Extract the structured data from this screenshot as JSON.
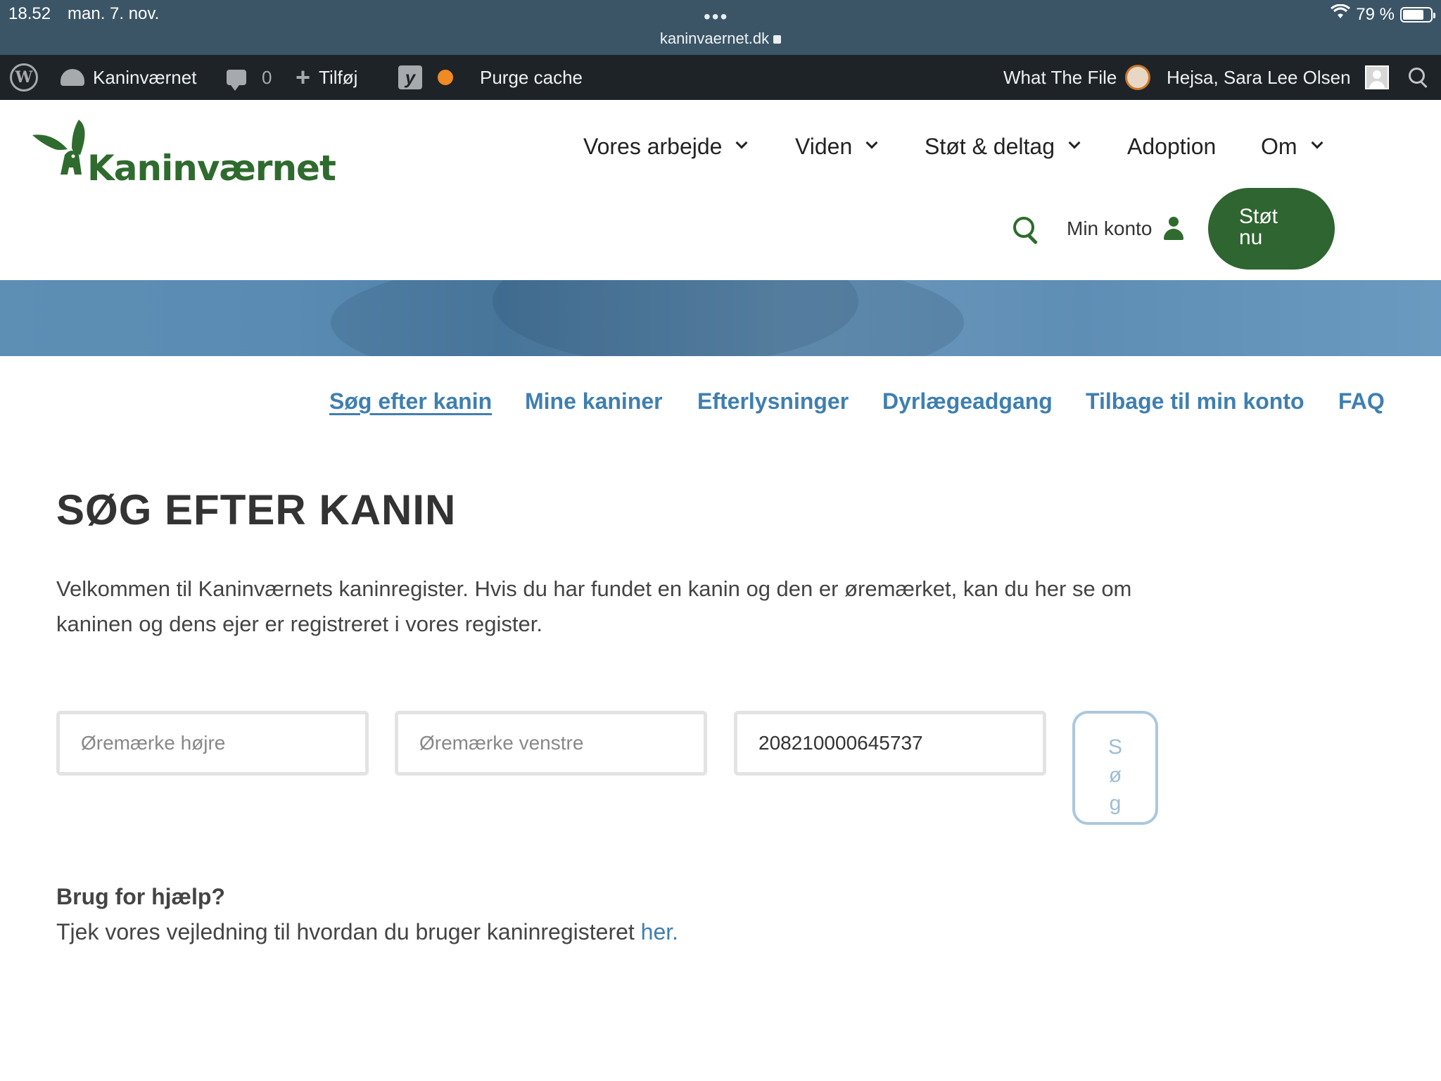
{
  "status_bar": {
    "time": "18.52",
    "date": "man. 7. nov.",
    "url": "kaninvaernet.dk",
    "battery": "79 %",
    "battery_level_percent": 79
  },
  "admin_bar": {
    "site_name": "Kaninværnet",
    "comments_count": "0",
    "add_new": "Tilføj",
    "purge_cache": "Purge cache",
    "what_the_file": "What The File",
    "greeting": "Hejsa, Sara Lee Olsen"
  },
  "header": {
    "logo_text": "Kaninværnet",
    "nav": [
      {
        "label": "Vores arbejde",
        "has_dropdown": true
      },
      {
        "label": "Viden",
        "has_dropdown": true
      },
      {
        "label": "Støt & deltag",
        "has_dropdown": true
      },
      {
        "label": "Adoption",
        "has_dropdown": false
      },
      {
        "label": "Om",
        "has_dropdown": true
      }
    ],
    "account_label": "Min konto",
    "cta_line1": "Støt",
    "cta_line2": "nu",
    "brand_green": "#2f6530"
  },
  "subnav": {
    "items": [
      "Søg efter kanin",
      "Mine kaniner",
      "Efterlysninger",
      "Dyrlægeadgang",
      "Tilbage til min konto",
      "FAQ"
    ],
    "active": "Søg efter kanin",
    "link_color": "#3f7fb0"
  },
  "main": {
    "title": "SØG EFTER KANIN",
    "intro": "Velkommen til Kaninværnets kaninregister. Hvis du har fundet en kanin og den er øremærket, kan du her se om kaninen og dens ejer er registreret i vores register.",
    "search": {
      "right_ear_placeholder": "Øremærke højre",
      "left_ear_placeholder": "Øremærke venstre",
      "chip_value": "208210000645737",
      "button_chars": [
        "S",
        "ø",
        "g"
      ]
    },
    "help_heading": "Brug for hjælp?",
    "help_text": "Tjek vores vejledning til hvordan du bruger kaninregisteret",
    "help_link": "her."
  }
}
